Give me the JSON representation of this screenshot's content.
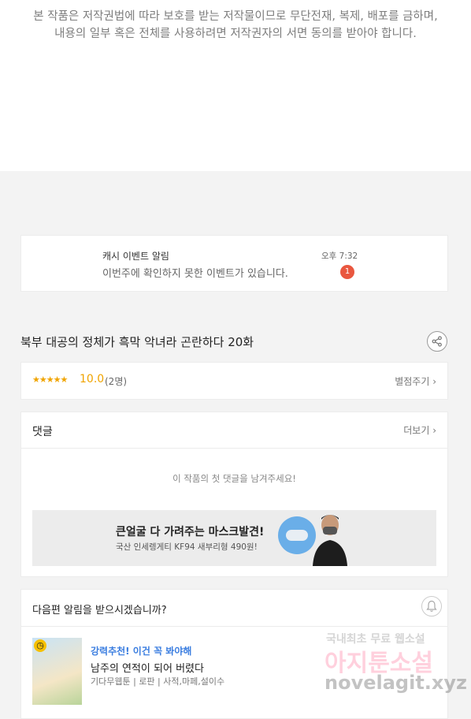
{
  "copyright": {
    "line1": "본 작품은 저작권법에 따라 보호를 받는 저작물이므로 무단전재, 복제,  배포를 금하며,",
    "line2": "내용의 일부 혹은 전체를 사용하려면 저작권자의 서면 동의를 받아야 합니다."
  },
  "notification": {
    "title": "캐시 이벤트 알림",
    "message": "이번주에 확인하지 못한 이벤트가 있습니다.",
    "time": "오후 7:32",
    "badge": "1"
  },
  "episode": {
    "title": "북부 대공의 정체가 흑막 악녀라 곤란하다 20화",
    "share_icon": "share-icon"
  },
  "rating": {
    "stars": "★★★★★",
    "score": "10.0",
    "count": "(2명)",
    "rate_button": "별점주기 ›"
  },
  "comments": {
    "header": "댓글",
    "more": "더보기 ›",
    "empty": "이 작품의 첫 댓글을 남겨주세요!"
  },
  "ad": {
    "headline": "큰얼굴 다 가려주는 마스크발견!",
    "subline": "국산 인세렝게티 KF94 새부리형 490원!"
  },
  "next_episode": {
    "question": "다음편 알림을 받으시겠습니까?",
    "bell_icon": "bell-icon",
    "recommend_tag": "강력추천! 이건 꼭 봐야해",
    "recommend_title": "남주의 연적이 되어 버렸다",
    "recommend_meta": "기다무웹툰 | 로판 | 사적,마페,설이수"
  },
  "watermark": {
    "line1": "국내최초 무료 웹소설",
    "line2": "아지툰소설",
    "line3": "novelagit.xyz"
  },
  "colors": {
    "accent_orange": "#f0a400",
    "badge_red": "#e9573f",
    "link_blue": "#3b7ee0",
    "background": "#f3f3f3"
  }
}
